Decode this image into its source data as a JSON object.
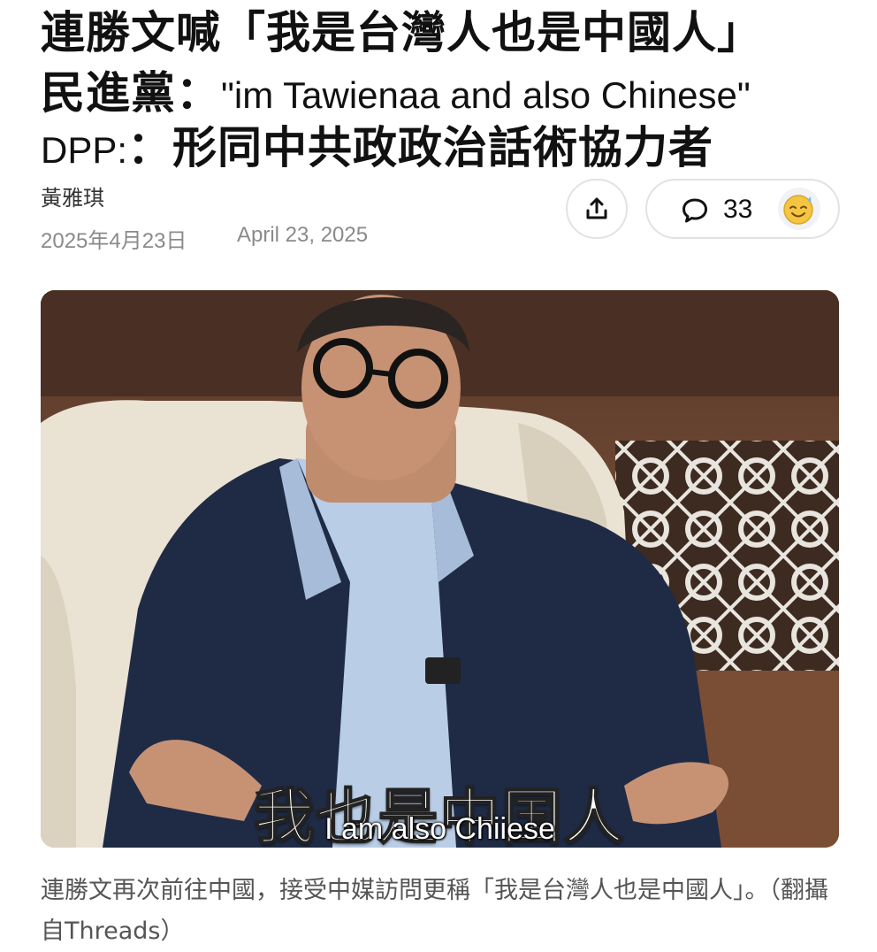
{
  "headline": {
    "line1": "連勝文喊「我是台灣人也是中國人」",
    "line2_cn": "民進黨：",
    "line2_en": "\"im Tawienaa and also Chinese\"",
    "line3_en": "DPP:",
    "line3_cn": "：形同中共政政治話術協力者"
  },
  "byline": {
    "author": "黃雅琪",
    "date_cn": "2025年4月23日",
    "date_en": "April 23, 2025"
  },
  "actions": {
    "share_icon": "share-upload-icon",
    "comment_icon": "comment-bubble-icon",
    "comment_count": "33",
    "reaction_icon": "sweat-smile-emoji-icon"
  },
  "photo": {
    "subtitle_cn": "我也是中国人",
    "subtitle_en": "I am also Chiiese"
  },
  "caption": "連勝文再次前往中國，接受中媒訪問更稱「我是台灣人也是中國人」。（翻攝自Threads）",
  "colors": {
    "text": "#111111",
    "muted": "#8a8a8a",
    "border": "#e2e2e2",
    "emoji": "#f5c542"
  }
}
